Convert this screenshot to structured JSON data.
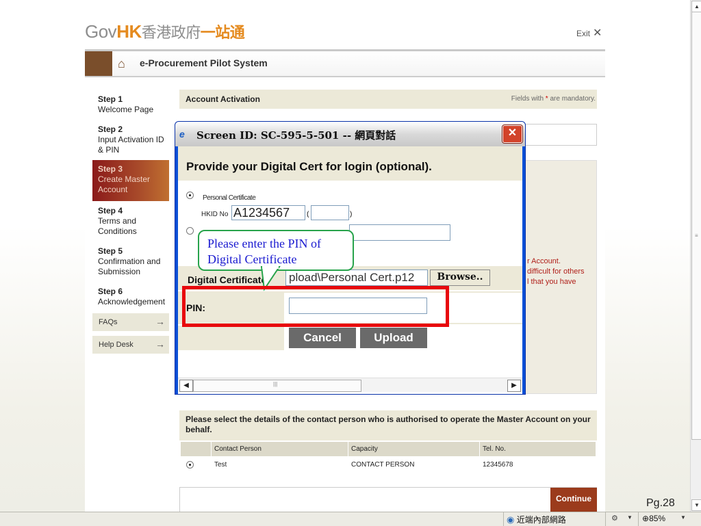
{
  "header": {
    "logo_gov": "Gov",
    "logo_hk": "HK",
    "logo_zh1": "香港政府",
    "logo_zh2": "一站通",
    "exit_label": "Exit",
    "exit_icon": "✕",
    "system_title": "e-Procurement Pilot System"
  },
  "steps": [
    {
      "num": "Step 1",
      "label": "Welcome Page"
    },
    {
      "num": "Step 2",
      "label": "Input Activation ID & PIN"
    },
    {
      "num": "Step 3",
      "label": "Create Master Account"
    },
    {
      "num": "Step 4",
      "label": "Terms and Conditions"
    },
    {
      "num": "Step 5",
      "label": "Confirmation and Submission"
    },
    {
      "num": "Step 6",
      "label": "Acknowledgement"
    }
  ],
  "sidebar_buttons": [
    {
      "label": "FAQs",
      "icon": "→"
    },
    {
      "label": "Help Desk",
      "icon": "→"
    }
  ],
  "main": {
    "section_title": "Account Activation",
    "mandatory_pre": "Fields with ",
    "mandatory_star": "*",
    "mandatory_post": " are mandatory.",
    "red_lines": [
      "r Account.",
      " difficult for others",
      "l that you have"
    ]
  },
  "contact": {
    "heading": "Please select the details of the contact person who is authorised to operate the Master Account on your behalf.",
    "columns": [
      "Contact Person",
      "Capacity",
      "Tel. No."
    ],
    "rows": [
      {
        "name": "Test",
        "capacity": "CONTACT PERSON",
        "tel": "12345678"
      }
    ],
    "continue_label": "Continue"
  },
  "page_number": "Pg.28",
  "dialog": {
    "title": "Screen ID: SC-595-5-501 -- 網頁對話",
    "close_icon": "✕",
    "heading": "Provide your Digital Cert for login (optional).",
    "personal_cert_label": "Personal Certificate",
    "hkid_label": "HKID No",
    "hkid_value": "A1234567",
    "hkid_open": "(",
    "hkid_close": ")",
    "digital_cert_label": "Digital Certificate:",
    "file_value": "pload\\Personal Cert.p12",
    "browse_label": "Browse..",
    "pin_label": "PIN:",
    "cancel_label": "Cancel",
    "upload_label": "Upload"
  },
  "callout": {
    "text_line1": "Please enter the PIN of",
    "text_line2": "Digital Certificate"
  },
  "statusbar": {
    "zone_text": "近端內部網路",
    "zoom_text": "85%"
  }
}
